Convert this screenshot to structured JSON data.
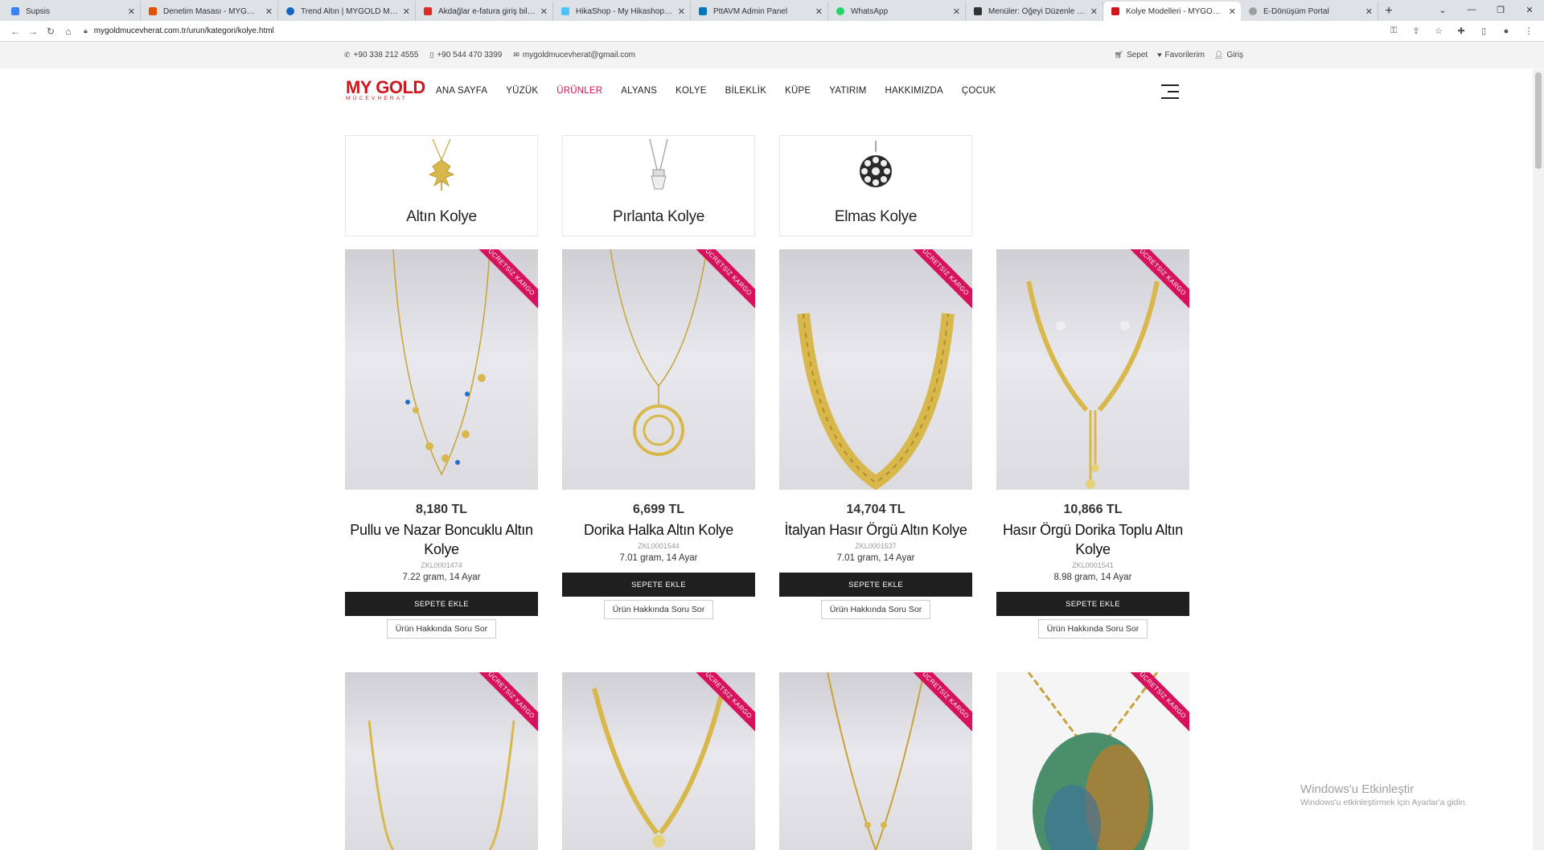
{
  "browser": {
    "tabs": [
      {
        "title": "Supsis",
        "color": "#3b82f6"
      },
      {
        "title": "Denetim Masası - MYGOLD Mücevher",
        "color": "#e65100"
      },
      {
        "title": "Trend Altın | MYGOLD Mücevher",
        "color": "#1565c0"
      },
      {
        "title": "Akdağlar e-fatura giriş bilgileri",
        "color": "#d93025"
      },
      {
        "title": "HikaShop - My Hikashop is disp",
        "color": "#4fc3f7"
      },
      {
        "title": "PttAVM Admin Panel",
        "color": "#0277bd"
      },
      {
        "title": "WhatsApp",
        "color": "#25d366"
      },
      {
        "title": "Menüler: Öğeyi Düzenle - MYGOLD",
        "color": "#333333"
      },
      {
        "title": "Kolye Modelleri - MYGOLD Mücevher",
        "color": "#d0161d",
        "active": true
      },
      {
        "title": "E-Dönüşüm Portal",
        "color": "#9e9e9e"
      }
    ],
    "url": "mygoldmucevherat.com.tr/urun/kategori/kolye.html"
  },
  "topbar": {
    "phone1": "+90 338 212 4555",
    "phone2": "+90 544 470 3399",
    "email": "mygoldmucevherat@gmail.com",
    "cart": "Sepet",
    "favorites": "Favorilerim",
    "login": "Giriş"
  },
  "logo": {
    "main": "MY GOLD",
    "sub": "MÜCEVHERAT"
  },
  "nav": [
    "ANA SAYFA",
    "YÜZÜK",
    "ÜRÜNLER",
    "ALYANS",
    "KOLYE",
    "BİLEKLİK",
    "KÜPE",
    "YATIRIM",
    "HAKKIMIZDA",
    "ÇOCUK"
  ],
  "categories": [
    "Altın Kolye",
    "Pırlanta Kolye",
    "Elmas Kolye"
  ],
  "ribbon": "ÜCRETSİZ KARGO",
  "buttons": {
    "add": "SEPETE EKLE",
    "ask": "Ürün Hakkında Soru Sor"
  },
  "products": [
    {
      "price": "8,180 TL",
      "name": "Pullu ve Nazar Boncuklu Altın Kolye",
      "code": "ZKL0001474",
      "weight": "7.22 gram, 14 Ayar"
    },
    {
      "price": "6,699 TL",
      "name": "Dorika Halka Altın Kolye",
      "code": "ZKL0001544",
      "weight": "7.01 gram, 14 Ayar"
    },
    {
      "price": "14,704 TL",
      "name": "İtalyan Hasır Örgü Altın Kolye",
      "code": "ZKL0001537",
      "weight": "7.01 gram, 14 Ayar"
    },
    {
      "price": "10,866 TL",
      "name": "Hasır Örgü Dorika Toplu Altın Kolye",
      "code": "ZKL0001541",
      "weight": "8.98 gram, 14 Ayar"
    }
  ],
  "watermark": {
    "line1": "Windows'u Etkinleştir",
    "line2": "Windows'u etkinleştirmek için Ayarlar'a gidin."
  }
}
